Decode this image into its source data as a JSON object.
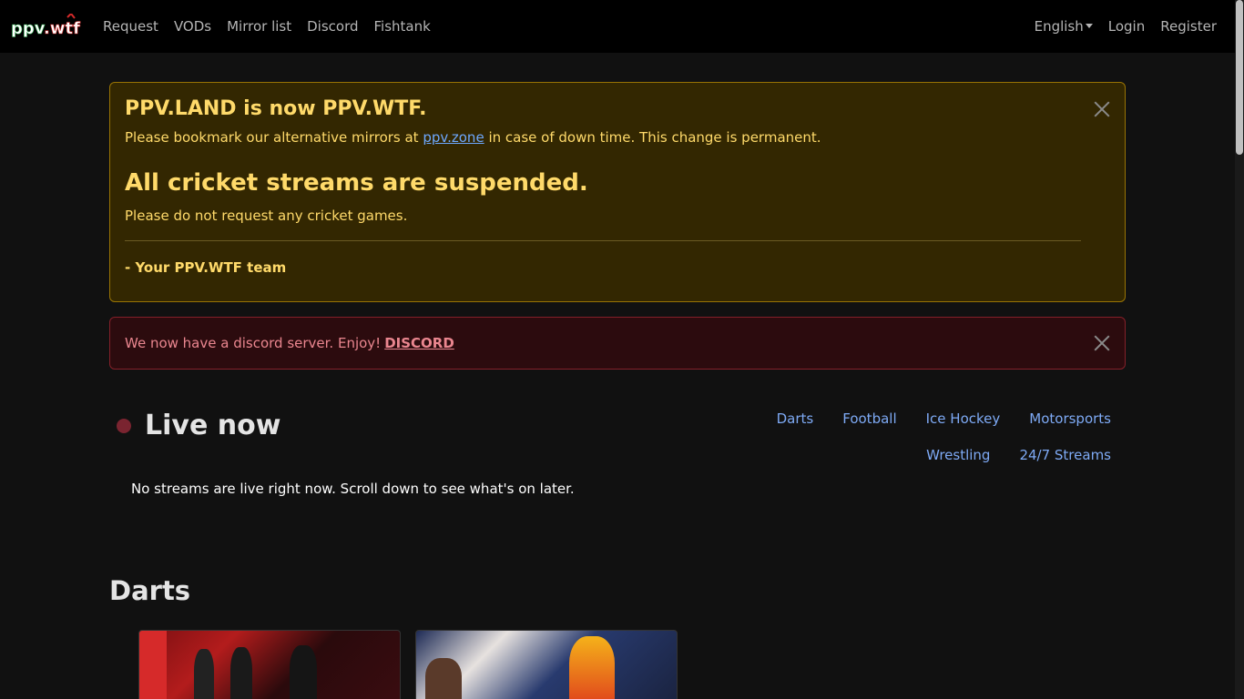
{
  "nav": {
    "logo_text": "ppv.wtf",
    "links": [
      "Request",
      "VODs",
      "Mirror list",
      "Discord",
      "Fishtank"
    ],
    "language": "English",
    "login": "Login",
    "register": "Register"
  },
  "alert_warning": {
    "heading1": "PPV.LAND is now PPV.WTF.",
    "line1_before": "Please bookmark our alternative mirrors at",
    "line1_link": "ppv.zone",
    "line1_after": "in case of down time. This change is permanent.",
    "heading2": "All cricket streams are suspended.",
    "line2": "Please do not request any cricket games.",
    "signature": "- Your PPV.WTF team"
  },
  "alert_danger": {
    "text": "We now have a discord server. Enjoy!",
    "link": "DISCORD"
  },
  "live": {
    "title": "Live now",
    "empty_message": "No streams are live right now. Scroll down to see what's on later.",
    "categories_row1": [
      "Darts",
      "Football",
      "Ice Hockey",
      "Motorsports"
    ],
    "categories_row2": [
      "Wrestling",
      "24/7 Streams"
    ]
  },
  "sections": [
    {
      "title": "Darts"
    }
  ],
  "colors": {
    "nav_bg": "#000000",
    "page_bg": "#111111",
    "warning_text": "#ffda6a",
    "danger_text": "#ea868f",
    "link": "#7eaaf5"
  }
}
